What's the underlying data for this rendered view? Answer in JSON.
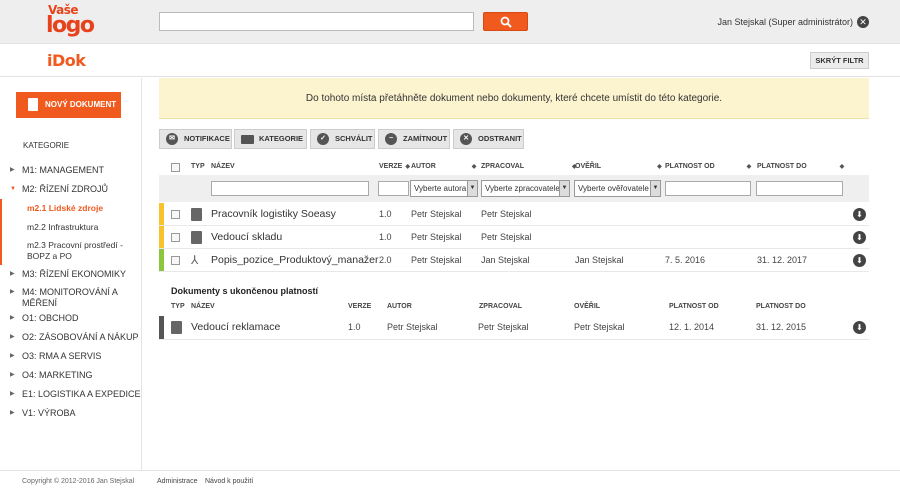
{
  "header": {
    "logo_line1": "Vaše",
    "logo_line2": "logo",
    "search_placeholder": "",
    "search_value": "",
    "user": "Jan Stejskal (Super administrátor)"
  },
  "appbar": {
    "title": "iDok",
    "hide_filter_label": "SKRÝT FILTR"
  },
  "sidebar": {
    "new_doc_label": "NOVÝ DOKUMENT",
    "categories_heading": "KATEGORIE",
    "items": [
      {
        "label": "M1: MANAGEMENT",
        "expanded": false
      },
      {
        "label": "M2: ŘÍZENÍ ZDROJŮ",
        "expanded": true
      },
      {
        "label": "M3: ŘÍZENÍ EKONOMIKY",
        "expanded": false
      },
      {
        "label": "M4: MONITOROVÁNÍ A MĚŘENÍ",
        "expanded": false
      },
      {
        "label": "O1: OBCHOD",
        "expanded": false
      },
      {
        "label": "O2: ZÁSOBOVÁNÍ A NÁKUP",
        "expanded": false
      },
      {
        "label": "O3: RMA A SERVIS",
        "expanded": false
      },
      {
        "label": "O4: MARKETING",
        "expanded": false
      },
      {
        "label": "E1: LOGISTIKA A EXPEDICE",
        "expanded": false
      },
      {
        "label": "V1: VÝROBA",
        "expanded": false
      }
    ],
    "subitems": [
      {
        "label": "m2.1 Lidské zdroje",
        "active": true
      },
      {
        "label": "m2.2 Infrastruktura",
        "active": false
      },
      {
        "label": "m2.3 Pracovní prostředí - BOPZ a PO",
        "active": false
      }
    ]
  },
  "dropzone": {
    "text": "Do tohoto místa přetáhněte dokument nebo dokumenty, které chcete umístit do této kategorie."
  },
  "actions": {
    "notify": "NOTIFIKACE",
    "category": "KATEGORIE",
    "approve": "SCHVÁLIT",
    "reject": "ZAMÍTNOUT",
    "remove": "ODSTRANIT"
  },
  "table": {
    "headers": {
      "type": "TYP",
      "name": "NÁZEV",
      "version": "VERZE",
      "author": "AUTOR",
      "processed": "ZPRACOVAL",
      "verified": "OVĚŘIL",
      "valid_from": "PLATNOST OD",
      "valid_to": "PLATNOST DO"
    },
    "filters": {
      "author": "Vyberte autora",
      "processed": "Vyberte zpracovatele",
      "verified": "Vyberte ověřovatele"
    },
    "rows": [
      {
        "status_color": "#f7c22a",
        "icon": "word",
        "name": "Pracovník logistiky Soeasy",
        "version": "1.0",
        "author": "Petr Stejskal",
        "processed": "Petr Stejskal",
        "verified": "",
        "valid_from": "",
        "valid_to": ""
      },
      {
        "status_color": "#f7c22a",
        "icon": "word",
        "name": "Vedoucí skladu",
        "version": "1.0",
        "author": "Petr Stejskal",
        "processed": "Petr Stejskal",
        "verified": "",
        "valid_from": "",
        "valid_to": ""
      },
      {
        "status_color": "#8cc63f",
        "icon": "pdf",
        "name": "Popis_pozice_Produktový_manažer",
        "version": "2.0",
        "author": "Petr Stejskal",
        "processed": "Jan Stejskal",
        "verified": "Jan Stejskal",
        "valid_from": "7. 5. 2016",
        "valid_to": "31. 12. 2017"
      }
    ]
  },
  "expired": {
    "title": "Dokumenty s ukončenou platností",
    "headers": {
      "type": "TYP",
      "name": "NÁZEV",
      "version": "VERZE",
      "author": "AUTOR",
      "processed": "ZPRACOVAL",
      "verified": "OVĚŘIL",
      "valid_from": "PLATNOST OD",
      "valid_to": "PLATNOST DO"
    },
    "rows": [
      {
        "status_color": "#555555",
        "icon": "word",
        "name": "Vedoucí reklamace",
        "version": "1.0",
        "author": "Petr Stejskal",
        "processed": "Petr Stejskal",
        "verified": "Petr Stejskal",
        "valid_from": "12. 1. 2014",
        "valid_to": "31. 12. 2015"
      }
    ]
  },
  "footer": {
    "copyright": "Copyright © 2012-2016 Jan Stejskal",
    "admin": "Administrace",
    "guide": "Návod k použití"
  }
}
